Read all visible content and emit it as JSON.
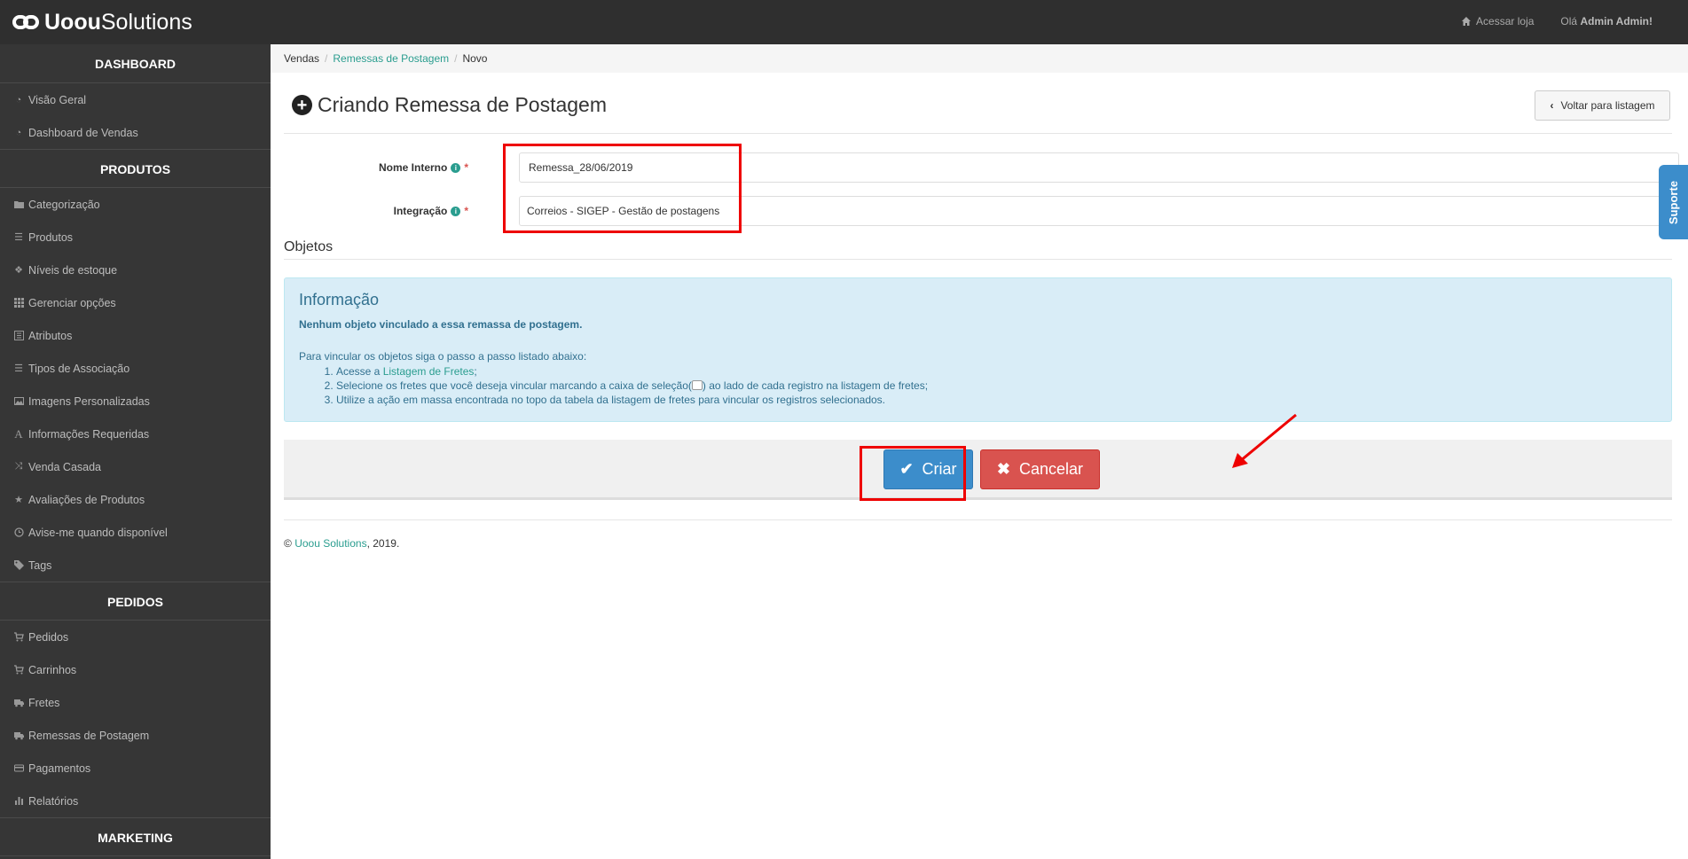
{
  "header": {
    "logo_bold": "Uoou",
    "logo_light": "Solutions",
    "store_link": "Acessar loja",
    "greeting": "Olá",
    "user": "Admin Admin!"
  },
  "sidebar": {
    "sections": [
      {
        "title": "DASHBOARD",
        "items": [
          {
            "label": "Visão Geral",
            "icon": "dashboard-icon"
          },
          {
            "label": "Dashboard de Vendas",
            "icon": "dashboard-icon"
          }
        ]
      },
      {
        "title": "PRODUTOS",
        "items": [
          {
            "label": "Categorização",
            "icon": "folder-icon"
          },
          {
            "label": "Produtos",
            "icon": "list-icon"
          },
          {
            "label": "Níveis de estoque",
            "icon": "cubes-icon"
          },
          {
            "label": "Gerenciar opções",
            "icon": "grid-icon"
          },
          {
            "label": "Atributos",
            "icon": "list-alt-icon"
          },
          {
            "label": "Tipos de Associação",
            "icon": "list-icon"
          },
          {
            "label": "Imagens Personalizadas",
            "icon": "image-icon"
          },
          {
            "label": "Informações Requeridas",
            "icon": "font-icon"
          },
          {
            "label": "Venda Casada",
            "icon": "random-icon"
          },
          {
            "label": "Avaliações de Produtos",
            "icon": "star-icon"
          },
          {
            "label": "Avise-me quando disponível",
            "icon": "clock-icon"
          },
          {
            "label": "Tags",
            "icon": "tag-icon"
          }
        ]
      },
      {
        "title": "PEDIDOS",
        "items": [
          {
            "label": "Pedidos",
            "icon": "cart-icon"
          },
          {
            "label": "Carrinhos",
            "icon": "cart-icon"
          },
          {
            "label": "Fretes",
            "icon": "truck-icon"
          },
          {
            "label": "Remessas de Postagem",
            "icon": "truck-icon"
          },
          {
            "label": "Pagamentos",
            "icon": "credit-card-icon"
          },
          {
            "label": "Relatórios",
            "icon": "bar-chart-icon"
          }
        ]
      },
      {
        "title": "MARKETING",
        "items": []
      }
    ]
  },
  "breadcrumb": {
    "root": "Vendas",
    "parent": "Remessas de Postagem",
    "current": "Novo"
  },
  "page": {
    "title": "Criando Remessa de Postagem",
    "back_button": "Voltar para listagem"
  },
  "form": {
    "nome_label": "Nome Interno",
    "nome_value": "Remessa_28/06/2019",
    "integracao_label": "Integração",
    "integracao_value": "Correios - SIGEP - Gestão de postagens",
    "required_mark": "*"
  },
  "objetos": {
    "title": "Objetos",
    "alert_title": "Informação",
    "alert_strong": "Nenhum objeto vinculado a essa remassa de postagem.",
    "alert_intro": "Para vincular os objetos siga o passo a passo listado abaixo:",
    "step1_pre": "Acesse a ",
    "step1_link": "Listagem de Fretes",
    "step1_post": ";",
    "step2_pre": "Selecione os fretes que você deseja vincular marcando a caixa de seleção(",
    "step2_post": ") ao lado de cada registro na listagem de fretes;",
    "step3": "Utilize a ação em massa encontrada no topo da tabela da listagem de fretes para vincular os registros selecionados."
  },
  "actions": {
    "submit": "Criar",
    "cancel": "Cancelar"
  },
  "footer": {
    "prefix": "© ",
    "company": "Uoou Solutions",
    "suffix": ", 2019."
  },
  "support_tab": "Suporte",
  "colors": {
    "accent": "#2a9d8f",
    "primary": "#3c8dcb",
    "danger": "#d9534f",
    "highlight": "#e00000"
  }
}
